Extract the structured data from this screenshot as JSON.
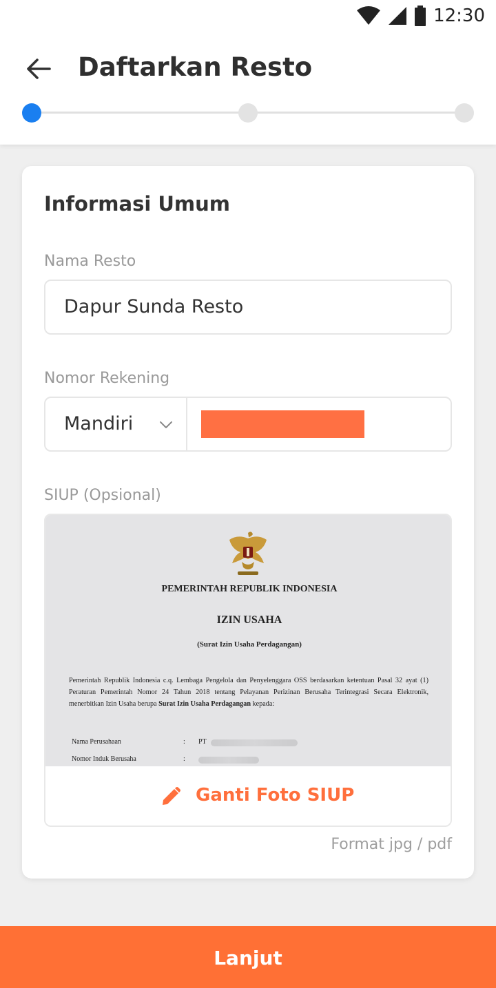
{
  "status_bar": {
    "time": "12:30",
    "icons": [
      "wifi-icon",
      "signal-icon",
      "battery-icon"
    ]
  },
  "header": {
    "title": "Daftarkan Resto",
    "back_icon": "arrow-left-icon"
  },
  "stepper": {
    "total_steps": 3,
    "current_step": 1,
    "active_color": "#1a7ff0"
  },
  "form": {
    "section_title": "Informasi Umum",
    "nama_resto": {
      "label": "Nama Resto",
      "value": "Dapur Sunda Resto"
    },
    "nomor_rekening": {
      "label": "Nomor Rekening",
      "bank": "Mandiri",
      "account_number_redacted": true
    },
    "siup": {
      "label": "SIUP (Opsional)",
      "document": {
        "heading": "PEMERINTAH REPUBLIK INDONESIA",
        "title": "IZIN USAHA",
        "subtitle": "(Surat Izin Usaha Perdagangan)",
        "paragraph_start": "Pemerintah Republik Indonesia c.q. Lembaga Pengelola dan Penyelenggara OSS berdasarkan ketentuan Pasal 32 ayat (1) Peraturan Pemerintah Nomor 24 Tahun 2018 tentang Pelayanan Perizinan Berusaha Terintegrasi Secara Elektronik, menerbitkan Izin Usaha berupa ",
        "paragraph_bold": "Surat Izin Usaha Perdagangan",
        "paragraph_end": " kepada:",
        "row1_label": "Nama Perusahaan",
        "row1_prefix": "PT",
        "row2_label": "Nomor Induk Berusaha",
        "colon": ":"
      },
      "change_button": "Ganti Foto SIUP",
      "format_hint": "Format jpg / pdf"
    }
  },
  "primary_button": {
    "label": "Lanjut",
    "color": "#ff7035"
  },
  "accent_color": "#ff6f3c"
}
